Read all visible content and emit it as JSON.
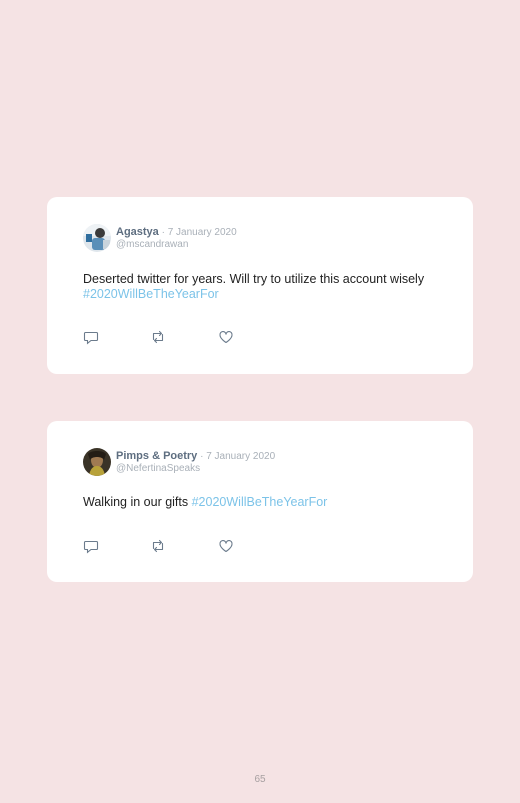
{
  "tweets": [
    {
      "name": "Agastya",
      "separator": " · ",
      "date": "7 January 2020",
      "handle": "@mscandrawan",
      "text": "Deserted twitter for years. Will try to utilize this account wisely ",
      "hashtag": "#2020WillBeTheYearFor",
      "avatar": "avatar-photo-icon"
    },
    {
      "name": "Pimps & Poetry",
      "separator": " · ",
      "date": "7 January 2020",
      "handle": "@NefertinaSpeaks",
      "text": "Walking in our gifts ",
      "hashtag": "#2020WillBeTheYearFor",
      "avatar": "avatar-photo-icon"
    }
  ],
  "actions": [
    "reply-icon",
    "retweet-icon",
    "like-icon"
  ],
  "colors": {
    "background": "#f5e3e4",
    "card": "#ffffff",
    "name": "#5e6e80",
    "meta": "#a9b0b8",
    "hashtag": "#7cc3e8"
  },
  "page_number": "65"
}
